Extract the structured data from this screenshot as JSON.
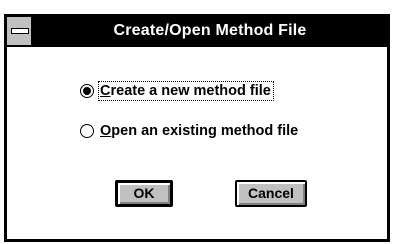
{
  "window": {
    "title": "Create/Open Method File",
    "sysmenu_icon": "system-menu-icon"
  },
  "options": [
    {
      "hotkey": "C",
      "rest": "reate a new method file",
      "selected": true
    },
    {
      "hotkey": "O",
      "rest": "pen an existing method file",
      "selected": false
    }
  ],
  "buttons": {
    "ok": "OK",
    "cancel": "Cancel"
  },
  "colors": {
    "titlebar": "#000000",
    "button_face": "#c0c0c0",
    "background": "#ffffff"
  }
}
